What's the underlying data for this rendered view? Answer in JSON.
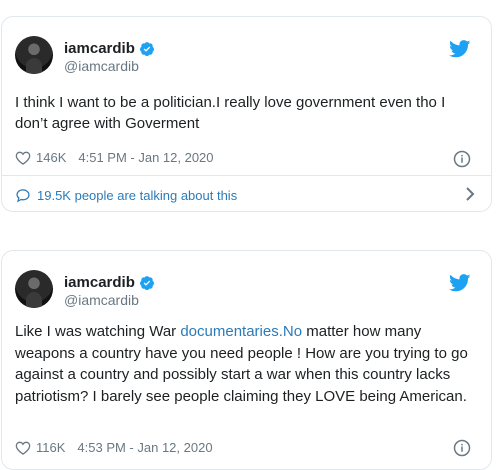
{
  "tweets": [
    {
      "name": "iamcardib",
      "handle": "@iamcardib",
      "text": "I think I want to be a politician.I really love government even tho I don’t agree with Goverment",
      "likes": "146K",
      "timestamp": "4:51 PM - Jan 12, 2020",
      "talking": "19.5K people are talking about this"
    },
    {
      "name": "iamcardib",
      "handle": "@iamcardib",
      "text_before_link": "Like I was watching War ",
      "link_text": "documentaries.No",
      "text_after_link": " matter how many weapons a country have you need people ! How are you trying to go against a country and possibly start a war when this country lacks patriotism? I barely see people claiming they LOVE being American.",
      "likes": "116K",
      "timestamp": "4:53 PM - Jan 12, 2020"
    }
  ],
  "colors": {
    "brand": "#1da1f2",
    "link": "#2b7bb9",
    "muted": "#697882",
    "border": "#e1e8ed"
  },
  "icons": [
    "avatar",
    "verified-badge-icon",
    "twitter-bird-icon",
    "heart-icon",
    "info-icon",
    "speech-bubble-icon",
    "chevron-right-icon"
  ]
}
